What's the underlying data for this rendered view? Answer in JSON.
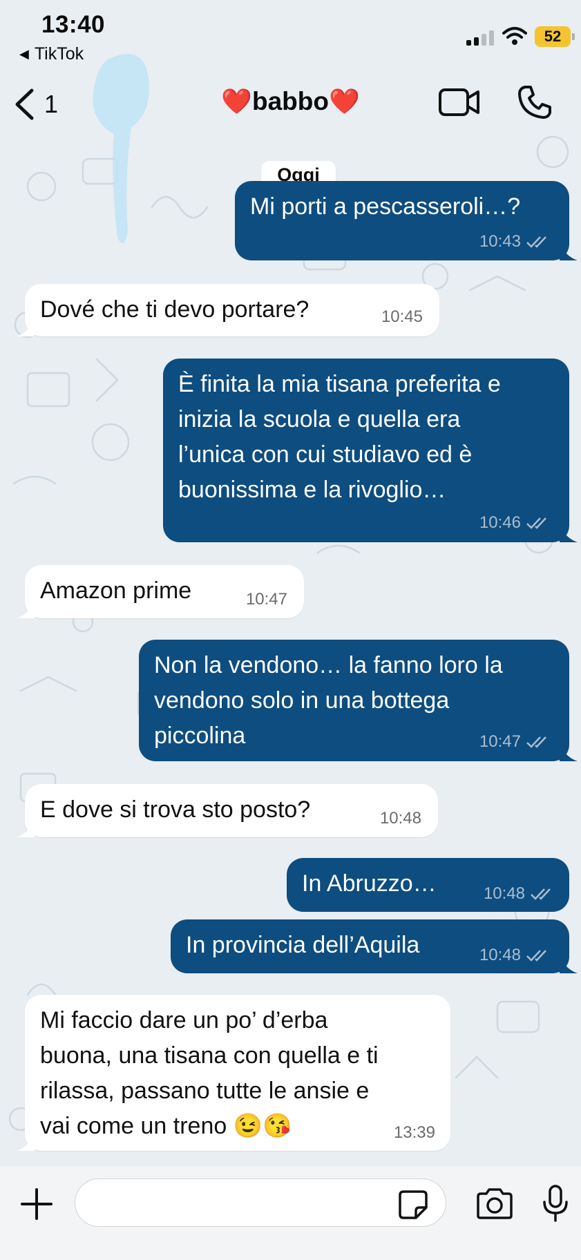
{
  "status_bar": {
    "time": "13:40",
    "back_app": "TikTok",
    "battery": "52"
  },
  "header": {
    "back_count": "1",
    "contact_name": "babbo",
    "heart_emoji": "❤️"
  },
  "chat": {
    "day_label": "Oggi",
    "messages": [
      {
        "dir": "out",
        "text": "Mi porti a pescasseroli…?",
        "time": "10:43"
      },
      {
        "dir": "in",
        "text": "Dové che ti devo portare?",
        "time": "10:45"
      },
      {
        "dir": "out",
        "lines": [
          "È finita la mia tisana preferita e",
          "inizia la scuola e quella era",
          "l’unica con cui studiavo ed è",
          "buonissima e la rivoglio…"
        ],
        "time": "10:46"
      },
      {
        "dir": "in",
        "text": "Amazon prime",
        "time": "10:47"
      },
      {
        "dir": "out",
        "lines": [
          "Non la vendono… la fanno loro la",
          "vendono solo in una bottega",
          "piccolina"
        ],
        "time": "10:47"
      },
      {
        "dir": "in",
        "text": "E dove si trova sto posto?",
        "time": "10:48"
      },
      {
        "dir": "out",
        "text": "In Abruzzo…",
        "time": "10:48"
      },
      {
        "dir": "out",
        "text": "In provincia dell’Aquila",
        "time": "10:48"
      },
      {
        "dir": "in",
        "lines": [
          "Mi faccio dare un po’ d’erba",
          "buona, una tisana con quella e ti",
          "rilassa, passano tutte le ansie e",
          "vai come un treno 😉😘"
        ],
        "time": "13:39"
      }
    ]
  },
  "input": {
    "placeholder": ""
  },
  "colors": {
    "outgoing_bubble": "#0e4d7f",
    "incoming_bubble": "#ffffff",
    "background": "#e8eef2",
    "battery": "#f4c430",
    "heart": "#e21a2c"
  },
  "icons": [
    "back-chevron-icon",
    "video-call-icon",
    "phone-icon",
    "plus-icon",
    "sticker-icon",
    "camera-icon",
    "microphone-icon",
    "read-checks-icon",
    "signal-icon",
    "wifi-icon"
  ]
}
